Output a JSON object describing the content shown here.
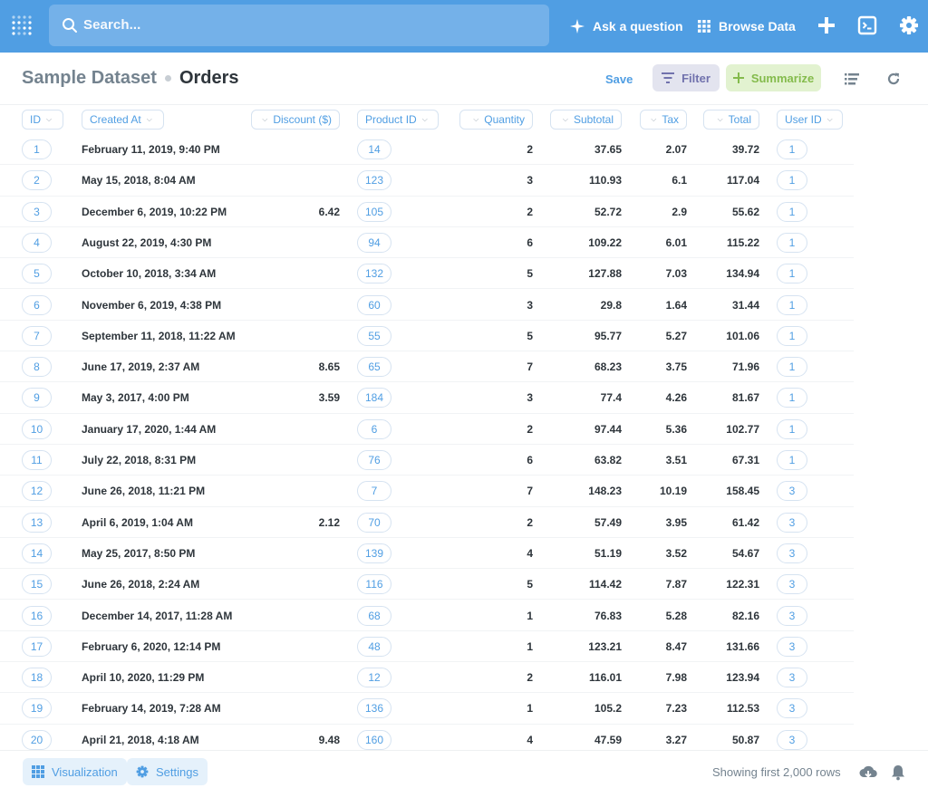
{
  "nav": {
    "search_placeholder": "Search...",
    "ask_label": "Ask a question",
    "browse_label": "Browse Data"
  },
  "header": {
    "database": "Sample Dataset",
    "table": "Orders",
    "save_label": "Save",
    "filter_label": "Filter",
    "summarize_label": "Summarize"
  },
  "columns": [
    "ID",
    "Created At",
    "Discount ($)",
    "Product ID",
    "Quantity",
    "Subtotal",
    "Tax",
    "Total",
    "User ID"
  ],
  "rows": [
    {
      "id": "1",
      "created": "February 11, 2019, 9:40 PM",
      "discount": "",
      "product": "14",
      "qty": "2",
      "subtotal": "37.65",
      "tax": "2.07",
      "total": "39.72",
      "user": "1"
    },
    {
      "id": "2",
      "created": "May 15, 2018, 8:04 AM",
      "discount": "",
      "product": "123",
      "qty": "3",
      "subtotal": "110.93",
      "tax": "6.1",
      "total": "117.04",
      "user": "1"
    },
    {
      "id": "3",
      "created": "December 6, 2019, 10:22 PM",
      "discount": "6.42",
      "product": "105",
      "qty": "2",
      "subtotal": "52.72",
      "tax": "2.9",
      "total": "55.62",
      "user": "1"
    },
    {
      "id": "4",
      "created": "August 22, 2019, 4:30 PM",
      "discount": "",
      "product": "94",
      "qty": "6",
      "subtotal": "109.22",
      "tax": "6.01",
      "total": "115.22",
      "user": "1"
    },
    {
      "id": "5",
      "created": "October 10, 2018, 3:34 AM",
      "discount": "",
      "product": "132",
      "qty": "5",
      "subtotal": "127.88",
      "tax": "7.03",
      "total": "134.94",
      "user": "1"
    },
    {
      "id": "6",
      "created": "November 6, 2019, 4:38 PM",
      "discount": "",
      "product": "60",
      "qty": "3",
      "subtotal": "29.8",
      "tax": "1.64",
      "total": "31.44",
      "user": "1"
    },
    {
      "id": "7",
      "created": "September 11, 2018, 11:22 AM",
      "discount": "",
      "product": "55",
      "qty": "5",
      "subtotal": "95.77",
      "tax": "5.27",
      "total": "101.06",
      "user": "1"
    },
    {
      "id": "8",
      "created": "June 17, 2019, 2:37 AM",
      "discount": "8.65",
      "product": "65",
      "qty": "7",
      "subtotal": "68.23",
      "tax": "3.75",
      "total": "71.96",
      "user": "1"
    },
    {
      "id": "9",
      "created": "May 3, 2017, 4:00 PM",
      "discount": "3.59",
      "product": "184",
      "qty": "3",
      "subtotal": "77.4",
      "tax": "4.26",
      "total": "81.67",
      "user": "1"
    },
    {
      "id": "10",
      "created": "January 17, 2020, 1:44 AM",
      "discount": "",
      "product": "6",
      "qty": "2",
      "subtotal": "97.44",
      "tax": "5.36",
      "total": "102.77",
      "user": "1"
    },
    {
      "id": "11",
      "created": "July 22, 2018, 8:31 PM",
      "discount": "",
      "product": "76",
      "qty": "6",
      "subtotal": "63.82",
      "tax": "3.51",
      "total": "67.31",
      "user": "1"
    },
    {
      "id": "12",
      "created": "June 26, 2018, 11:21 PM",
      "discount": "",
      "product": "7",
      "qty": "7",
      "subtotal": "148.23",
      "tax": "10.19",
      "total": "158.45",
      "user": "3"
    },
    {
      "id": "13",
      "created": "April 6, 2019, 1:04 AM",
      "discount": "2.12",
      "product": "70",
      "qty": "2",
      "subtotal": "57.49",
      "tax": "3.95",
      "total": "61.42",
      "user": "3"
    },
    {
      "id": "14",
      "created": "May 25, 2017, 8:50 PM",
      "discount": "",
      "product": "139",
      "qty": "4",
      "subtotal": "51.19",
      "tax": "3.52",
      "total": "54.67",
      "user": "3"
    },
    {
      "id": "15",
      "created": "June 26, 2018, 2:24 AM",
      "discount": "",
      "product": "116",
      "qty": "5",
      "subtotal": "114.42",
      "tax": "7.87",
      "total": "122.31",
      "user": "3"
    },
    {
      "id": "16",
      "created": "December 14, 2017, 11:28 AM",
      "discount": "",
      "product": "68",
      "qty": "1",
      "subtotal": "76.83",
      "tax": "5.28",
      "total": "82.16",
      "user": "3"
    },
    {
      "id": "17",
      "created": "February 6, 2020, 12:14 PM",
      "discount": "",
      "product": "48",
      "qty": "1",
      "subtotal": "123.21",
      "tax": "8.47",
      "total": "131.66",
      "user": "3"
    },
    {
      "id": "18",
      "created": "April 10, 2020, 11:29 PM",
      "discount": "",
      "product": "12",
      "qty": "2",
      "subtotal": "116.01",
      "tax": "7.98",
      "total": "123.94",
      "user": "3"
    },
    {
      "id": "19",
      "created": "February 14, 2019, 7:28 AM",
      "discount": "",
      "product": "136",
      "qty": "1",
      "subtotal": "105.2",
      "tax": "7.23",
      "total": "112.53",
      "user": "3"
    },
    {
      "id": "20",
      "created": "April 21, 2018, 4:18 AM",
      "discount": "9.48",
      "product": "160",
      "qty": "4",
      "subtotal": "47.59",
      "tax": "3.27",
      "total": "50.87",
      "user": "3"
    }
  ],
  "footer": {
    "visualization_label": "Visualization",
    "settings_label": "Settings",
    "row_count": "Showing first 2,000 rows"
  },
  "colors": {
    "brand": "#509ee3",
    "filter": "#7172ad",
    "summarize": "#84bb4c"
  }
}
